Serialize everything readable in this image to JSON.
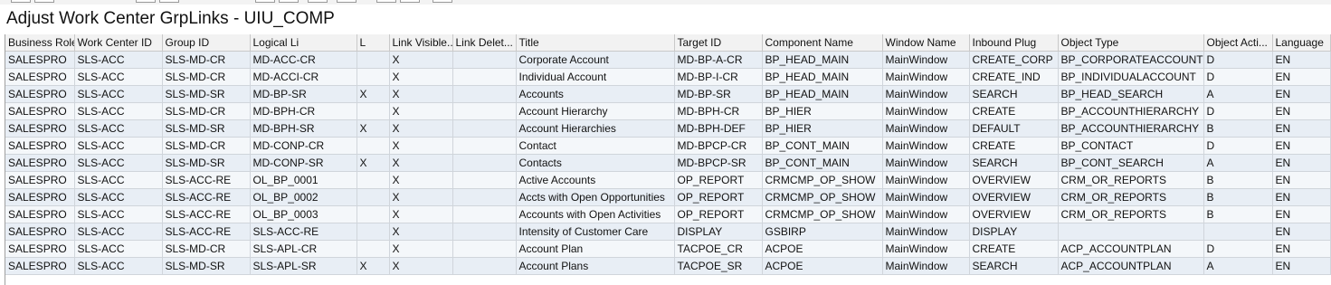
{
  "window": {
    "title": "Adjust Work Center GrpLinks - UIU_COMP"
  },
  "table": {
    "columns": [
      "Business Role",
      "Work Center ID",
      "Group ID",
      "Logical Li",
      "L",
      "Link Visible...",
      "Link Delet...",
      "Title",
      "Target ID",
      "Component Name",
      "Window Name",
      "Inbound Plug",
      "Object Type",
      "Object Acti...",
      "Language"
    ],
    "rows": [
      [
        "SALESPRO",
        "SLS-ACC",
        "SLS-MD-CR",
        "MD-ACC-CR",
        "",
        "X",
        "",
        "Corporate Account",
        "MD-BP-A-CR",
        "BP_HEAD_MAIN",
        "MainWindow",
        "CREATE_CORP",
        "BP_CORPORATEACCOUNT",
        "D",
        "EN"
      ],
      [
        "SALESPRO",
        "SLS-ACC",
        "SLS-MD-CR",
        "MD-ACCI-CR",
        "",
        "X",
        "",
        "Individual Account",
        "MD-BP-I-CR",
        "BP_HEAD_MAIN",
        "MainWindow",
        "CREATE_IND",
        "BP_INDIVIDUALACCOUNT",
        "D",
        "EN"
      ],
      [
        "SALESPRO",
        "SLS-ACC",
        "SLS-MD-SR",
        "MD-BP-SR",
        "X",
        "X",
        "",
        "Accounts",
        "MD-BP-SR",
        "BP_HEAD_MAIN",
        "MainWindow",
        "SEARCH",
        "BP_HEAD_SEARCH",
        "A",
        "EN"
      ],
      [
        "SALESPRO",
        "SLS-ACC",
        "SLS-MD-CR",
        "MD-BPH-CR",
        "",
        "X",
        "",
        "Account Hierarchy",
        "MD-BPH-CR",
        "BP_HIER",
        "MainWindow",
        "CREATE",
        "BP_ACCOUNTHIERARCHY",
        "D",
        "EN"
      ],
      [
        "SALESPRO",
        "SLS-ACC",
        "SLS-MD-SR",
        "MD-BPH-SR",
        "X",
        "X",
        "",
        "Account Hierarchies",
        "MD-BPH-DEF",
        "BP_HIER",
        "MainWindow",
        "DEFAULT",
        "BP_ACCOUNTHIERARCHY",
        "B",
        "EN"
      ],
      [
        "SALESPRO",
        "SLS-ACC",
        "SLS-MD-CR",
        "MD-CONP-CR",
        "",
        "X",
        "",
        "Contact",
        "MD-BPCP-CR",
        "BP_CONT_MAIN",
        "MainWindow",
        "CREATE",
        "BP_CONTACT",
        "D",
        "EN"
      ],
      [
        "SALESPRO",
        "SLS-ACC",
        "SLS-MD-SR",
        "MD-CONP-SR",
        "X",
        "X",
        "",
        "Contacts",
        "MD-BPCP-SR",
        "BP_CONT_MAIN",
        "MainWindow",
        "SEARCH",
        "BP_CONT_SEARCH",
        "A",
        "EN"
      ],
      [
        "SALESPRO",
        "SLS-ACC",
        "SLS-ACC-RE",
        "OL_BP_0001",
        "",
        "X",
        "",
        "Active Accounts",
        "OP_REPORT",
        "CRMCMP_OP_SHOW",
        "MainWindow",
        "OVERVIEW",
        "CRM_OR_REPORTS",
        "B",
        "EN"
      ],
      [
        "SALESPRO",
        "SLS-ACC",
        "SLS-ACC-RE",
        "OL_BP_0002",
        "",
        "X",
        "",
        "Accts with Open Opportunities",
        "OP_REPORT",
        "CRMCMP_OP_SHOW",
        "MainWindow",
        "OVERVIEW",
        "CRM_OR_REPORTS",
        "B",
        "EN"
      ],
      [
        "SALESPRO",
        "SLS-ACC",
        "SLS-ACC-RE",
        "OL_BP_0003",
        "",
        "X",
        "",
        "Accounts with Open Activities",
        "OP_REPORT",
        "CRMCMP_OP_SHOW",
        "MainWindow",
        "OVERVIEW",
        "CRM_OR_REPORTS",
        "B",
        "EN"
      ],
      [
        "SALESPRO",
        "SLS-ACC",
        "SLS-ACC-RE",
        "SLS-ACC-RE",
        "",
        "X",
        "",
        "Intensity of Customer Care",
        "DISPLAY",
        "GSBIRP",
        "MainWindow",
        "DISPLAY",
        "",
        "",
        "EN"
      ],
      [
        "SALESPRO",
        "SLS-ACC",
        "SLS-MD-CR",
        "SLS-APL-CR",
        "",
        "X",
        "",
        "Account Plan",
        "TACPOE_CR",
        "ACPOE",
        "MainWindow",
        "CREATE",
        "ACP_ACCOUNTPLAN",
        "D",
        "EN"
      ],
      [
        "SALESPRO",
        "SLS-ACC",
        "SLS-MD-SR",
        "SLS-APL-SR",
        "X",
        "X",
        "",
        "Account Plans",
        "TACPOE_SR",
        "ACPOE",
        "MainWindow",
        "SEARCH",
        "ACP_ACCOUNTPLAN",
        "A",
        "EN"
      ]
    ]
  }
}
